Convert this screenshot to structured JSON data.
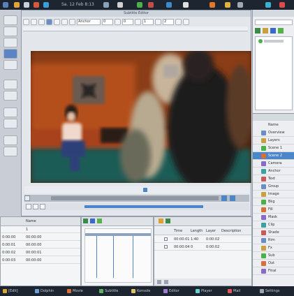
{
  "topbar": {
    "clock": "Sa. 12 Feb 8:13",
    "window_title": "Subtitle Editor"
  },
  "main_window": {
    "title": "Subtitle Editor",
    "toolbar_fields": [
      "Anchor",
      "0",
      "0",
      "1",
      "2"
    ]
  },
  "video": {
    "description_colors": {
      "background": "#3a1d10",
      "wall": "#b4501c",
      "sofa": "#1f5c57"
    }
  },
  "subtitle_table": {
    "columns": [
      "Time",
      "Length",
      "Layer",
      "Description"
    ],
    "rows": [
      {
        "time": "00:00:01",
        "length": "1:40",
        "layer": "0:00:02"
      },
      {
        "time": "00:00:04",
        "length": "0",
        "layer": "0:00:02"
      }
    ]
  },
  "left_table": {
    "header": "Name",
    "rows": [
      {
        "a": "",
        "b": "1"
      },
      {
        "a": "0:00:00",
        "b": "00:00:00"
      },
      {
        "a": "0:00:01",
        "b": "00:00:00"
      },
      {
        "a": "0:00:02",
        "b": "00:00:01"
      },
      {
        "a": "0:00:03",
        "b": "00:00:00"
      }
    ]
  },
  "taskbar": {
    "items": [
      {
        "label": "[Edit]",
        "color": "#d9a43a"
      },
      {
        "label": "Dolphin",
        "color": "#6ea0d8"
      },
      {
        "label": "Movie",
        "color": "#d86f3a"
      },
      {
        "label": "Subtitle",
        "color": "#5bb25b"
      },
      {
        "label": "Konsole",
        "color": "#e0c06a"
      },
      {
        "label": "Editor",
        "color": "#a07ad8"
      },
      {
        "label": "Player",
        "color": "#6ad0d0"
      },
      {
        "label": "Mail",
        "color": "#e05a5a"
      },
      {
        "label": "Settings",
        "color": "#9aa3ae"
      }
    ]
  },
  "right_panel": {
    "header": "Name",
    "items": [
      "Overview",
      "Layers",
      "Scene 1",
      "Scene 2",
      "Camera",
      "Anchor",
      "Text",
      "Group",
      "Image",
      "Bkg",
      "Fill",
      "Mask",
      "Clip",
      "Shade",
      "Rim",
      "Fx",
      "Sub",
      "Out",
      "Final"
    ]
  },
  "colors": {
    "accent": "#4a86c8",
    "panel_bg": "#eceef2",
    "dark_bar": "#1d2530"
  }
}
